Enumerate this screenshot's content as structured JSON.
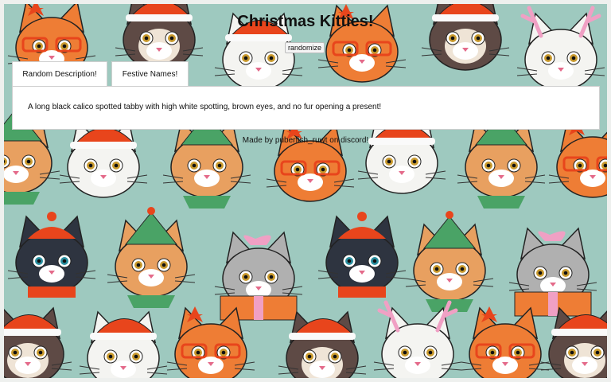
{
  "page": {
    "title": "Christmas Kitties!",
    "randomize_label": "randomize",
    "footer": "Made by puberfish_ruwt on discord!"
  },
  "tabs": [
    {
      "label": "Random Description!",
      "active": true
    },
    {
      "label": "Festive Names!",
      "active": false
    }
  ],
  "panel": {
    "description": "A long black calico spotted tabby with high white spotting, brown eyes, and no fur opening a present!"
  },
  "background": {
    "pattern": "christmas-cats-pattern",
    "colors": {
      "base": "#9ec9bf",
      "santa_hat": "#e8451c",
      "cat_orange": "#ee7d35",
      "cat_white": "#f4f4f1",
      "cat_dark": "#2e3440",
      "siamese": "#5e4a45",
      "pink_antler": "#f0a0c4",
      "elf_green": "#4aa366"
    }
  }
}
